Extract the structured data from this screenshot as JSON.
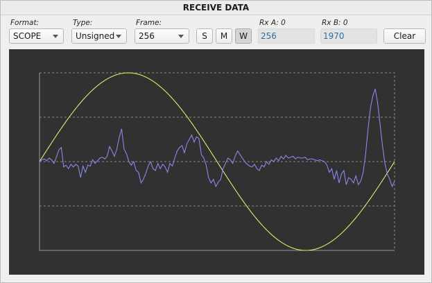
{
  "window": {
    "title": "RECEIVE DATA"
  },
  "controls": {
    "format": {
      "label": "Format:",
      "value": "SCOPE"
    },
    "type": {
      "label": "Type:",
      "value": "Unsigned"
    },
    "frame": {
      "label": "Frame:",
      "value": "256"
    },
    "buttons": {
      "s": "S",
      "m": "M",
      "w": "W",
      "clear": "Clear"
    },
    "rx_a": {
      "label": "Rx A: 0",
      "value": "256"
    },
    "rx_b": {
      "label": "Rx B: 0",
      "value": "1970"
    }
  },
  "scope": {
    "background": "#313131",
    "grid_color": "#8a8a8a",
    "series": [
      {
        "color": "#e8e86a",
        "shape": "sine",
        "cycles": 1
      },
      {
        "color": "#8a88ee",
        "values": [
          0.0,
          0.02,
          0.03,
          0.01,
          0.04,
          0.02,
          -0.02,
          0.05,
          0.13,
          0.16,
          -0.06,
          -0.04,
          -0.08,
          -0.03,
          -0.06,
          -0.03,
          -0.05,
          -0.18,
          -0.05,
          -0.12,
          -0.04,
          -0.05,
          0.02,
          -0.02,
          0.01,
          0.04,
          0.05,
          0.03,
          0.06,
          0.17,
          0.12,
          0.06,
          0.14,
          0.27,
          0.37,
          0.14,
          0.09,
          0.0,
          -0.04,
          0.0,
          -0.1,
          -0.12,
          -0.24,
          -0.2,
          -0.13,
          -0.05,
          0.0,
          -0.08,
          -0.1,
          -0.02,
          -0.08,
          -0.03,
          -0.06,
          -0.12,
          -0.02,
          -0.05,
          0.04,
          0.12,
          0.16,
          0.18,
          0.1,
          0.2,
          0.25,
          0.3,
          0.22,
          0.28,
          0.26,
          0.08,
          0.04,
          -0.04,
          -0.18,
          -0.24,
          -0.2,
          -0.28,
          -0.23,
          -0.2,
          -0.08,
          -0.02,
          0.04,
          0.02,
          -0.02,
          0.06,
          0.12,
          0.08,
          0.04,
          0.0,
          -0.03,
          -0.05,
          -0.06,
          -0.03,
          -0.08,
          -0.1,
          -0.04,
          -0.06,
          0.0,
          -0.03,
          0.02,
          0.0,
          0.04,
          0.01,
          0.06,
          0.03,
          0.07,
          0.04,
          0.05,
          0.06,
          0.03,
          0.05,
          0.04,
          0.04,
          0.05,
          0.02,
          0.03,
          0.03,
          0.02,
          0.01,
          0.02,
          0.01,
          0.0,
          -0.04,
          -0.12,
          -0.08,
          -0.2,
          -0.1,
          -0.24,
          -0.14,
          -0.1,
          -0.26,
          -0.18,
          -0.2,
          -0.24,
          -0.16,
          -0.26,
          -0.22,
          -0.12,
          0.08,
          0.36,
          0.6,
          0.74,
          0.82,
          0.66,
          0.42,
          0.18,
          -0.02,
          -0.14,
          -0.2,
          -0.28,
          -0.22
        ]
      }
    ]
  }
}
